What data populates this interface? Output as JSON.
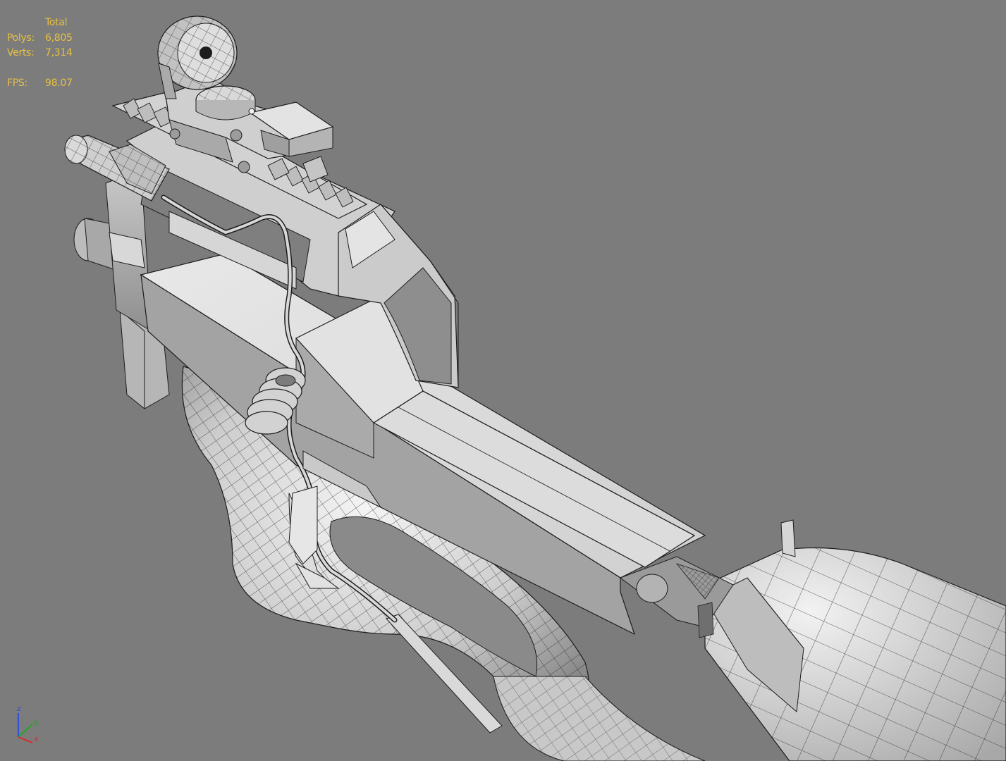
{
  "viewport": {
    "background": "#7c7c7c",
    "shading": "smooth + edged faces"
  },
  "statistics": {
    "header": "Total",
    "polys_label": "Polys:",
    "polys_value": "6,805",
    "verts_label": "Verts:",
    "verts_value": "7,314",
    "fps_label": "FPS:",
    "fps_value": "98.07",
    "text_color": "#e8c040"
  },
  "axis_gizmo": {
    "z_label": "z",
    "y_label": "y",
    "x_label": "x",
    "z_color": "#2f4fd8",
    "y_color": "#1faa1f",
    "x_color": "#d82a2a"
  },
  "model": {
    "subject": "submachine-gun-wireframe",
    "parts": [
      "barrel-stock",
      "frame-body",
      "grip",
      "trigger-guard",
      "top-rail",
      "reflex-sight",
      "flashlight",
      "coiled-cable",
      "magazine"
    ],
    "surface_color": "#e6e6e6",
    "wire_color": "#1c1c1c"
  }
}
